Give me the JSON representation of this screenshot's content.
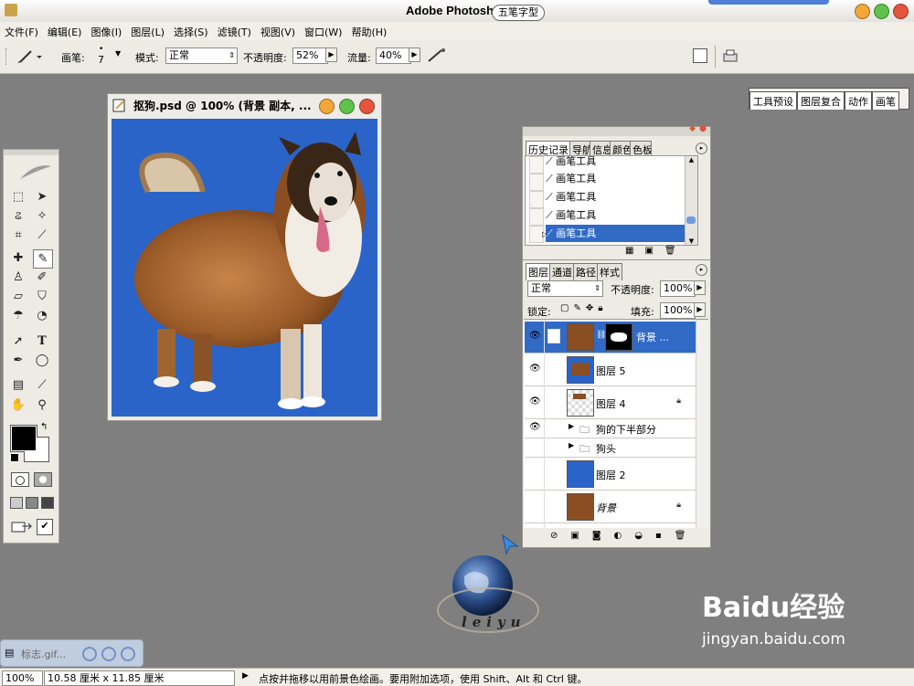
{
  "window": {
    "title": "Adobe Photoshop",
    "ime_indicator": "五笔字型"
  },
  "menu": [
    "文件(F)",
    "编辑(E)",
    "图像(I)",
    "图层(L)",
    "选择(S)",
    "滤镜(T)",
    "视图(V)",
    "窗口(W)",
    "帮助(H)"
  ],
  "options": {
    "brush_label": "画笔:",
    "brush_size": "7",
    "mode_label": "模式:",
    "mode_value": "正常",
    "opacity_label": "不透明度:",
    "opacity_value": "52%",
    "flow_label": "流量:",
    "flow_value": "40%"
  },
  "palette_well": {
    "tabs": [
      "工具预设",
      "图层复合",
      "动作",
      "画笔"
    ]
  },
  "document": {
    "title": "抠狗.psd @ 100% (背景 副本, ..."
  },
  "history": {
    "tabs": [
      "历史记录",
      "导航器",
      "信息",
      "颜色",
      "色板"
    ],
    "items": [
      "画笔工具",
      "画笔工具",
      "画笔工具",
      "画笔工具",
      "画笔工具"
    ],
    "selected_index": 4
  },
  "layers": {
    "tabs": [
      "图层",
      "通道",
      "路径",
      "样式"
    ],
    "blend_mode": "正常",
    "opacity_label": "不透明度:",
    "opacity_value": "100%",
    "lock_label": "锁定:",
    "fill_label": "填充:",
    "fill_value": "100%",
    "items": [
      {
        "name": "背景 ...",
        "visible": true,
        "selected": true,
        "has_mask": true
      },
      {
        "name": "图层 5",
        "visible": true
      },
      {
        "name": "图层 4",
        "visible": true,
        "locked": true
      },
      {
        "name": "狗的下半部分",
        "visible": true,
        "group": true
      },
      {
        "name": "狗头",
        "visible": false,
        "group": true
      },
      {
        "name": "图层 2",
        "visible": false
      },
      {
        "name": "背景",
        "visible": false,
        "locked": true
      }
    ]
  },
  "status": {
    "zoom": "100%",
    "doc_size": "10.58 厘米 x 11.85 厘米",
    "hint": "点按并拖移以用前景色绘画。要用附加选项，使用 Shift、Alt 和 Ctrl 键。"
  },
  "taskbar_thumb": {
    "label": "标志.gif..."
  },
  "logo": {
    "text": "leiyu"
  },
  "watermark": {
    "brand": "Baidu经验",
    "url": "jingyan.baidu.com"
  },
  "colors": {
    "selection_blue": "#316ac5",
    "canvas_blue": "#2a64c8",
    "workspace": "#7f7f7f"
  }
}
